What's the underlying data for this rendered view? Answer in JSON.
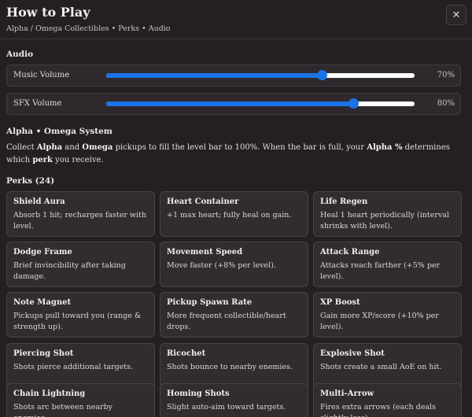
{
  "header": {
    "title": "How to Play",
    "subtitle": "Alpha / Omega Collectibles • Perks • Audio",
    "close_glyph": "✕",
    "close_icon": "close-icon"
  },
  "audio": {
    "heading": "Audio",
    "music": {
      "label": "Music Volume",
      "value": 70,
      "value_text": "70%"
    },
    "sfx": {
      "label": "SFX Volume",
      "value": 80,
      "value_text": "80%"
    },
    "accent_color": "#1a73e8"
  },
  "system": {
    "heading": "Alpha • Omega System",
    "parts": {
      "p1": "Collect ",
      "b1": "Alpha",
      "p2": " and ",
      "b2": "Omega",
      "p3": " pickups to fill the level bar to 100%. When the bar is full, your ",
      "b3": "Alpha %",
      "p4": " determines which ",
      "b4": "perk",
      "p5": " you receive."
    }
  },
  "perks": {
    "heading": "Perks (24)",
    "items": [
      {
        "name": "Shield Aura",
        "desc": "Absorb 1 hit; recharges faster with level."
      },
      {
        "name": "Heart Container",
        "desc": "+1 max heart; fully heal on gain."
      },
      {
        "name": "Life Regen",
        "desc": "Heal 1 heart periodically (interval shrinks with level)."
      },
      {
        "name": "Dodge Frame",
        "desc": "Brief invincibility after taking damage."
      },
      {
        "name": "Movement Speed",
        "desc": "Move faster (+8% per level)."
      },
      {
        "name": "Attack Range",
        "desc": "Attacks reach farther (+5% per level)."
      },
      {
        "name": "Note Magnet",
        "desc": "Pickups pull toward you (range & strength up)."
      },
      {
        "name": "Pickup Spawn Rate",
        "desc": "More frequent collectible/heart drops."
      },
      {
        "name": "XP Boost",
        "desc": "Gain more XP/score (+10% per level)."
      },
      {
        "name": "Piercing Shot",
        "desc": "Shots pierce additional targets."
      },
      {
        "name": "Ricochet",
        "desc": "Shots bounce to nearby enemies."
      },
      {
        "name": "Explosive Shot",
        "desc": "Shots create a small AoE on hit."
      },
      {
        "name": "Chain Lightning",
        "desc": "Shots arc between nearby enemies."
      },
      {
        "name": "Homing Shots",
        "desc": "Slight auto-aim toward targets."
      },
      {
        "name": "Multi-Arrow",
        "desc": "Fires extra arrows (each deals slightly less)."
      }
    ]
  }
}
